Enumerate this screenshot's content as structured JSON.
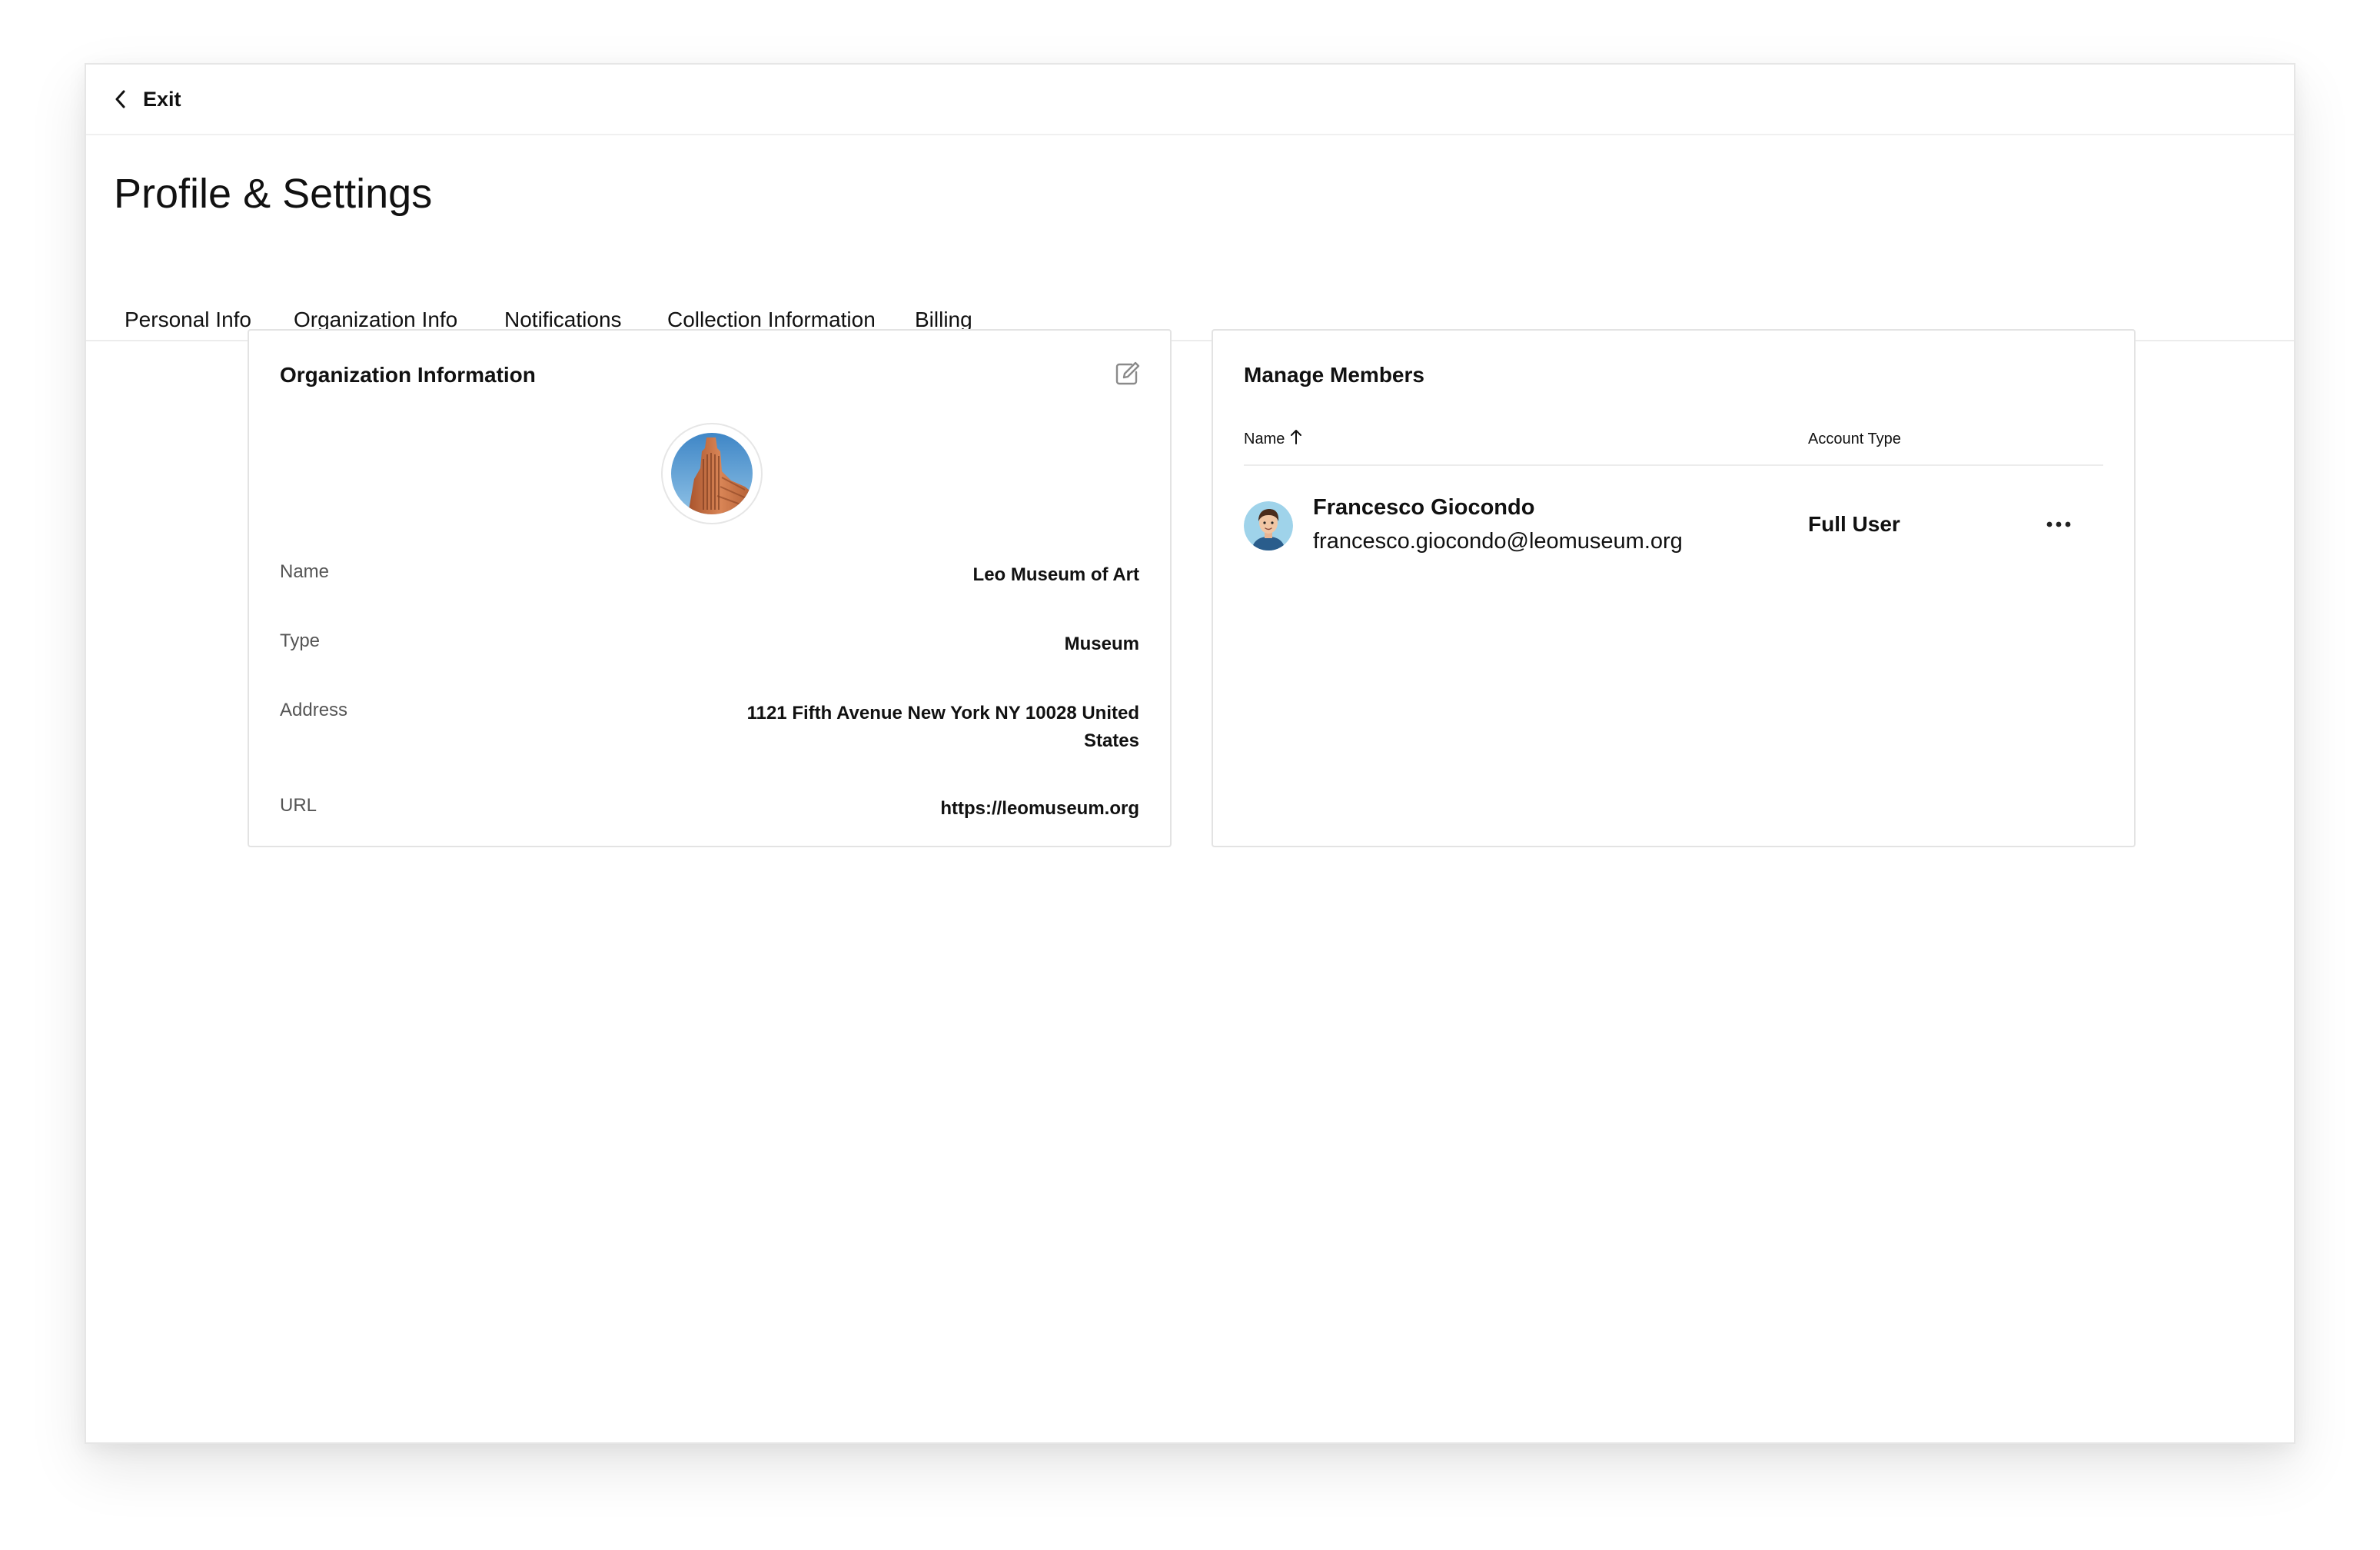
{
  "topbar": {
    "exit_label": "Exit",
    "back_icon": "chevron-left-icon"
  },
  "page": {
    "title": "Profile & Settings"
  },
  "tabs": [
    {
      "label": "Personal Info",
      "active": false
    },
    {
      "label": "Organization Info",
      "active": true
    },
    {
      "label": "Notifications",
      "active": false
    },
    {
      "label": "Collection Information",
      "active": false
    },
    {
      "label": "Billing",
      "active": false
    }
  ],
  "organization": {
    "card_title": "Organization Information",
    "edit_icon": "edit-icon",
    "fields": [
      {
        "label": "Name",
        "value": "Leo Museum of Art"
      },
      {
        "label": "Type",
        "value": "Museum"
      },
      {
        "label": "Address",
        "value": "1121 Fifth Avenue New York NY 10028 United States"
      },
      {
        "label": "URL",
        "value": "https://leomuseum.org"
      }
    ]
  },
  "members": {
    "card_title": "Manage Members",
    "columns": {
      "name": "Name",
      "account_type": "Account Type",
      "sort_icon": "arrow-up-icon"
    },
    "rows": [
      {
        "name": "Francesco Giocondo",
        "email": "francesco.giocondo@leomuseum.org",
        "account_type": "Full User",
        "more_icon": "more-horizontal-icon"
      }
    ]
  },
  "colors": {
    "text": "#111111",
    "muted_label": "#555555",
    "border": "#e3e3e3",
    "avatar_bg": "#9fd3ea",
    "building": "#c8744a"
  }
}
